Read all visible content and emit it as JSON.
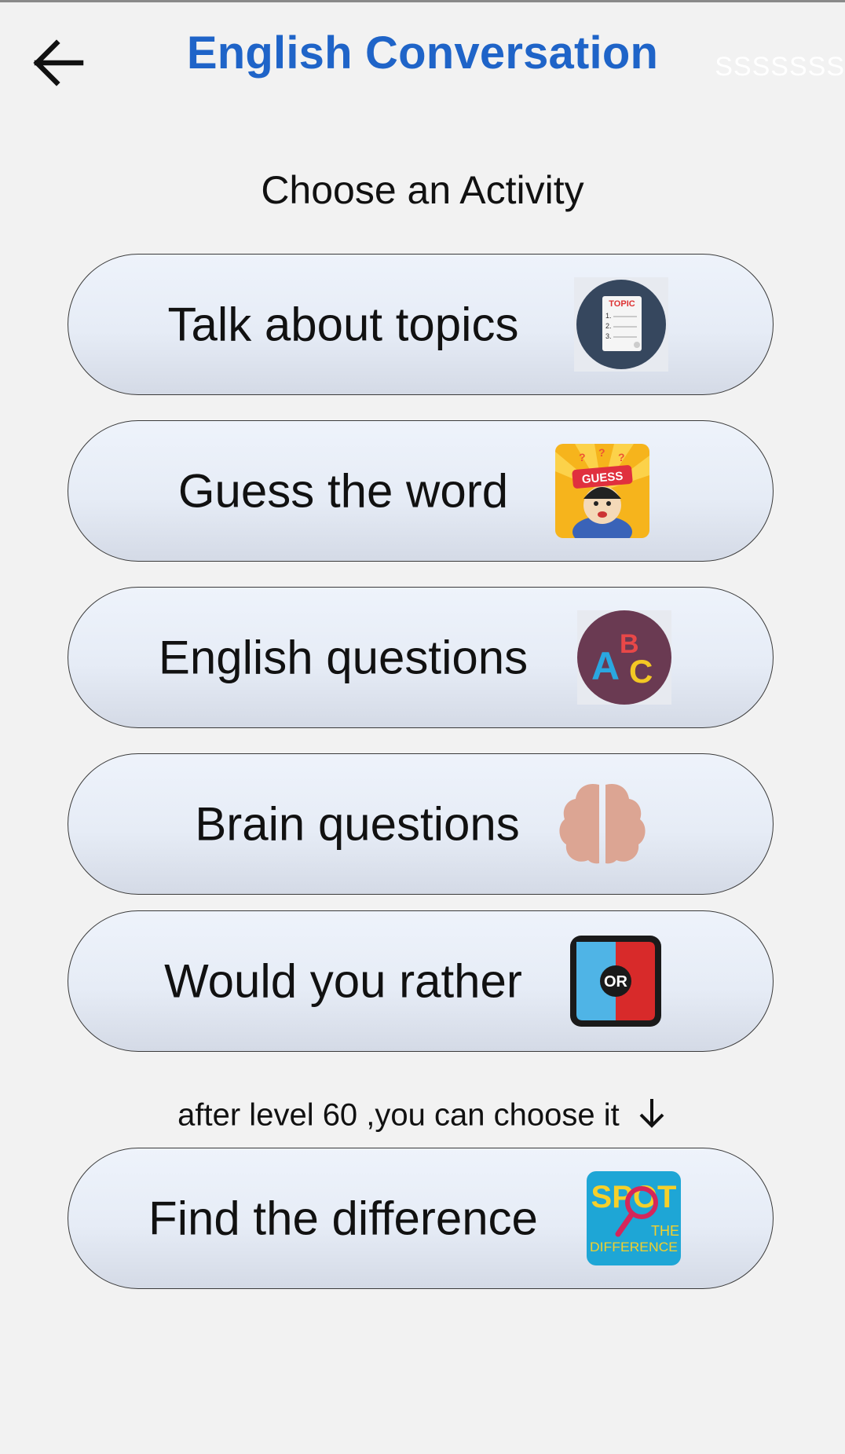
{
  "header": {
    "title": "English Conversation",
    "ghost_text": "SSSSSSS",
    "back_icon": "back-arrow-icon"
  },
  "subtitle": "Choose an Activity",
  "activities": [
    {
      "label": "Talk about topics",
      "icon": "topic-list-icon"
    },
    {
      "label": "Guess the word",
      "icon": "guess-character-icon"
    },
    {
      "label": "English questions",
      "icon": "abc-letters-icon"
    },
    {
      "label": "Brain questions",
      "icon": "brain-icon"
    },
    {
      "label": "Would you rather",
      "icon": "or-choice-icon"
    }
  ],
  "note": "after level 60 ,you can choose it",
  "locked_activity": {
    "label": "Find the difference",
    "icon": "spot-the-difference-icon"
  },
  "icon_text": {
    "topic": "TOPIC",
    "topic_items": [
      "1.",
      "2.",
      "3."
    ],
    "guess": "GUESS",
    "abc": [
      "A",
      "B",
      "C"
    ],
    "or": "OR",
    "spot": "SPOT",
    "the": "THE",
    "difference": "DIFFERENCE"
  },
  "colors": {
    "title": "#1f64c8",
    "background": "#f2f2f2",
    "card_border": "#3a3a3a"
  }
}
